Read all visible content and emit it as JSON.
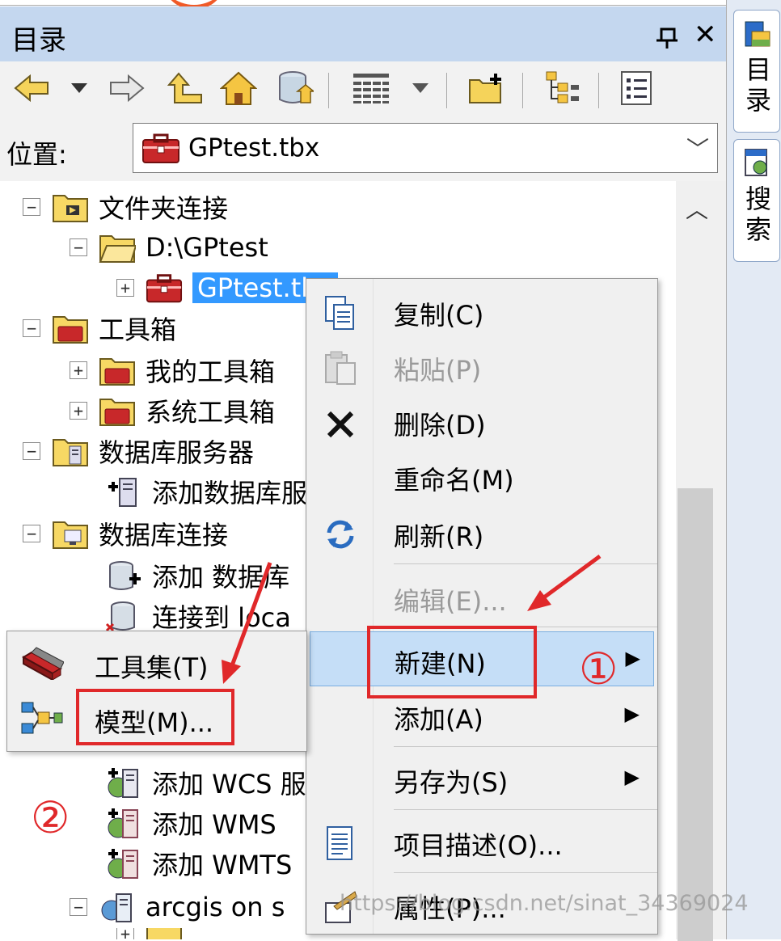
{
  "colors": {
    "selection": "#3399ff",
    "annotation_red": "#e0282a",
    "titlebar": "#c4d7ef",
    "menu_hover": "#c5def7"
  },
  "panel": {
    "title": "目录"
  },
  "toolbar": {
    "icons": [
      "back-arrow-icon",
      "dropdown-arrow-icon",
      "forward-arrow-icon",
      "up-level-icon",
      "home-icon",
      "default-geodatabase-icon",
      "list-view-icon",
      "dropdown-arrow-icon",
      "connect-folder-icon",
      "tree-view-icon",
      "options-icon"
    ]
  },
  "location": {
    "label": "位置:",
    "value": "GPtest.tbx"
  },
  "tree": {
    "folder_connections": "文件夹连接",
    "gptest_folder": "D:\\GPtest",
    "gptest_tbx": "GPtest.tbx",
    "toolboxes": "工具箱",
    "my_toolboxes": "我的工具箱",
    "system_toolboxes": "系统工具箱",
    "database_servers": "数据库服务器",
    "add_database_server": "添加数据库服",
    "database_connections": "数据库连接",
    "add_database_connection": "添加 数据库",
    "connect_to_localhost": "连接到 loca",
    "add_wcs": "添加 WCS 服",
    "add_wms": "添加 WMS",
    "add_wmts": "添加 WMTS",
    "arcgis_online": "arcgis on s"
  },
  "side_tabs": {
    "catalog": "目录",
    "search": "搜索"
  },
  "context_menu": {
    "copy": "复制(C)",
    "paste": "粘贴(P)",
    "delete": "删除(D)",
    "rename": "重命名(M)",
    "refresh": "刷新(R)",
    "edit": "编辑(E)...",
    "new": "新建(N)",
    "add": "添加(A)",
    "save_as": "另存为(S)",
    "item_description": "项目描述(O)...",
    "properties": "属性(P)..."
  },
  "submenu": {
    "toolset": "工具集(T)",
    "model": "模型(M)..."
  },
  "annotations": {
    "marker_1": "①",
    "marker_2": "②"
  },
  "watermark": "https://blog.csdn.net/sinat_34369024"
}
